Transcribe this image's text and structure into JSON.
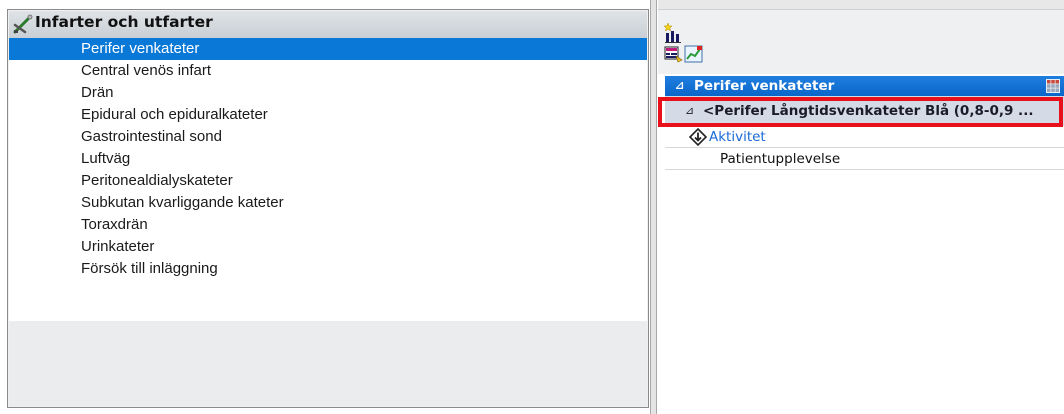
{
  "left_panel": {
    "title": "Infarter och utfarter",
    "header_icon": "catheter-tools-icon",
    "items": [
      {
        "label": "Perifer venkateter",
        "selected": true
      },
      {
        "label": "Central venös infart"
      },
      {
        "label": "Drän"
      },
      {
        "label": "Epidural och epiduralkateter"
      },
      {
        "label": "Gastrointestinal sond"
      },
      {
        "label": "Luftväg"
      },
      {
        "label": "Peritonealdialyskateter"
      },
      {
        "label": "Subkutan kvarliggande kateter"
      },
      {
        "label": "Toraxdrän"
      },
      {
        "label": "Urinkateter"
      },
      {
        "label": "Försök till inläggning"
      }
    ]
  },
  "right_panel": {
    "toolbar_icons": [
      "new-chart-icon",
      "flowsheet-icon",
      "graph-icon"
    ],
    "section": {
      "title": "Perifer venkateter",
      "collapse_glyph": "⊿",
      "grid_icon": "grid-view-icon"
    },
    "group_row": {
      "collapse_glyph": "⊿",
      "label": "<Perifer Långtidsvenkateter Blå (0,8-0,9 ..."
    },
    "activity_row": {
      "label": "Aktivitet",
      "icon": "activity-icon"
    },
    "experience_row": {
      "label": "Patientupplevelse"
    }
  },
  "colors": {
    "selection": "#0a78d7",
    "section_header": "#0b66c9",
    "highlight": "#e8101a",
    "link": "#1a6ad8"
  }
}
